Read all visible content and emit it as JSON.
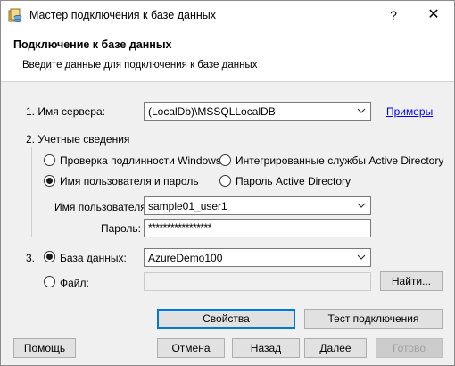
{
  "window": {
    "title": "Мастер подключения к базе данных",
    "help": "?",
    "close": "✕"
  },
  "header": {
    "title": "Подключение к базе данных",
    "subtitle": "Введите данные для подключения к базе данных"
  },
  "server": {
    "label": "1. Имя сервера:",
    "value": "(LocalDb)\\MSSQLLocalDB",
    "examples_link": "Примеры"
  },
  "credentials": {
    "label": "2. Учетные сведения",
    "options": {
      "windows": "Проверка подлинности Windows",
      "ad_integrated": "Интегрированные службы Active Directory",
      "user_password": "Имя пользователя и пароль",
      "ad_password": "Пароль Active Directory"
    },
    "selected": "user_password",
    "username_label": "Имя пользователя:",
    "username_value": "sample01_user1",
    "password_label": "Пароль:",
    "password_value": "*****************"
  },
  "database": {
    "number": "3.",
    "db_label": "База данных:",
    "db_value": "AzureDemo100",
    "file_label": "Файл:",
    "file_value": "",
    "find_button": "Найти...",
    "selected": "database"
  },
  "actions": {
    "properties": "Свойства",
    "test": "Тест подключения"
  },
  "footer": {
    "help": "Помощь",
    "cancel": "Отмена",
    "back": "Назад",
    "next": "Далее",
    "finish": "Готово"
  }
}
